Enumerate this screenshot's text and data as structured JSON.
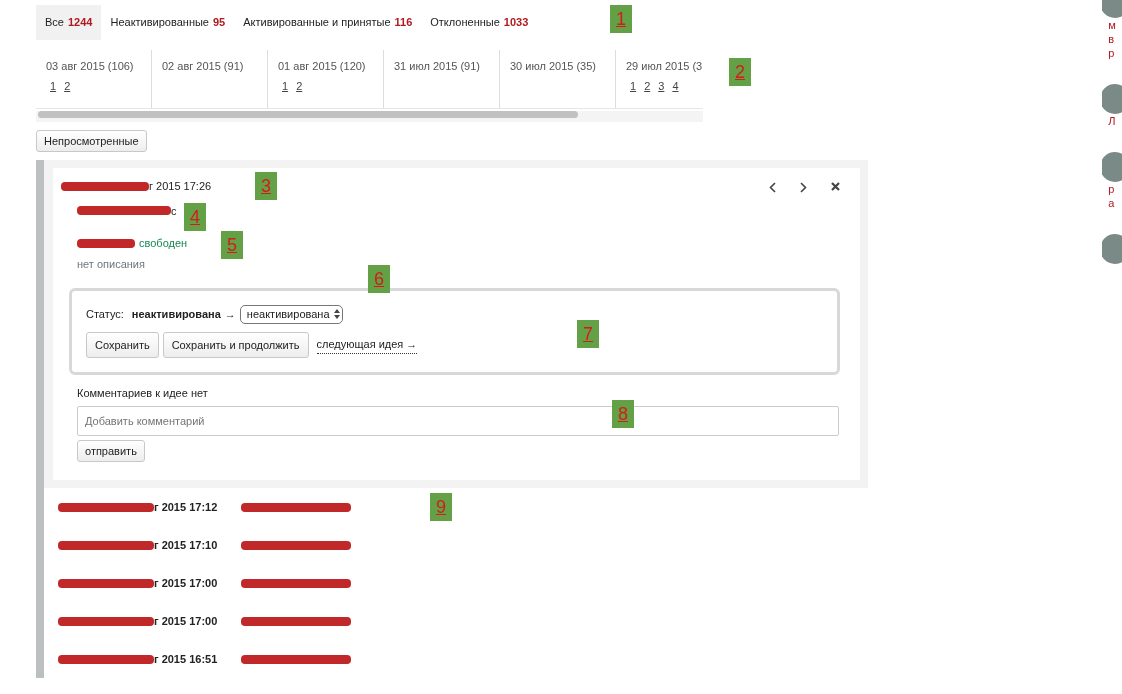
{
  "filter_tabs": [
    {
      "label": "Все",
      "count": "1244",
      "selected": true
    },
    {
      "label": "Неактивированные",
      "count": "95",
      "selected": false
    },
    {
      "label": "Активированные и принятые",
      "count": "116",
      "selected": false
    },
    {
      "label": "Отклоненные",
      "count": "1033",
      "selected": false
    }
  ],
  "date_columns": [
    {
      "label": "03 авг 2015 (106)",
      "pages": [
        "1",
        "2"
      ]
    },
    {
      "label": "02 авг 2015 (91)"
    },
    {
      "label": "01 авг 2015 (120)",
      "pages": [
        "1",
        "2"
      ]
    },
    {
      "label": "31 июл 2015 (91)"
    },
    {
      "label": "30 июл 2015 (35)"
    },
    {
      "label": "29 июл 2015 (3",
      "pages": [
        "1",
        "2",
        "3",
        "4"
      ]
    }
  ],
  "unviewed_button": "Непросмотренные",
  "open_idea": {
    "timestamp": "г 2015 17:26",
    "author_tail": "с",
    "availability": "свободен",
    "description": "нет описания",
    "status": {
      "label": "Статус:",
      "current": "неактивирована",
      "arrow": "→",
      "select_value": "неактивирована"
    },
    "buttons": [
      "Сохранить",
      "Сохранить и продолжить"
    ],
    "next_link": "следующая идея →",
    "comments_heading": "Комментариев к идее нет",
    "comment_field": {
      "placeholder": "Добавить комментарий"
    },
    "send_button": "отправить"
  },
  "ideas": [
    {
      "timestamp": "г 2015 17:12"
    },
    {
      "timestamp": "г 2015 17:10"
    },
    {
      "timestamp": "г 2015 17:00"
    },
    {
      "timestamp": "г 2015 17:00"
    },
    {
      "timestamp": "г 2015 16:51"
    }
  ],
  "sidebar": [
    {
      "kind": "avatar",
      "lines": [
        "м",
        "в",
        "р"
      ]
    },
    {
      "kind": "avatar",
      "lines": [
        "Л"
      ]
    },
    {
      "kind": "avatar",
      "lines": [
        "р",
        "а"
      ]
    },
    {
      "kind": "avatar"
    }
  ],
  "annotations": [
    "1",
    "2",
    "3",
    "4",
    "5",
    "6",
    "7",
    "8",
    "9"
  ]
}
